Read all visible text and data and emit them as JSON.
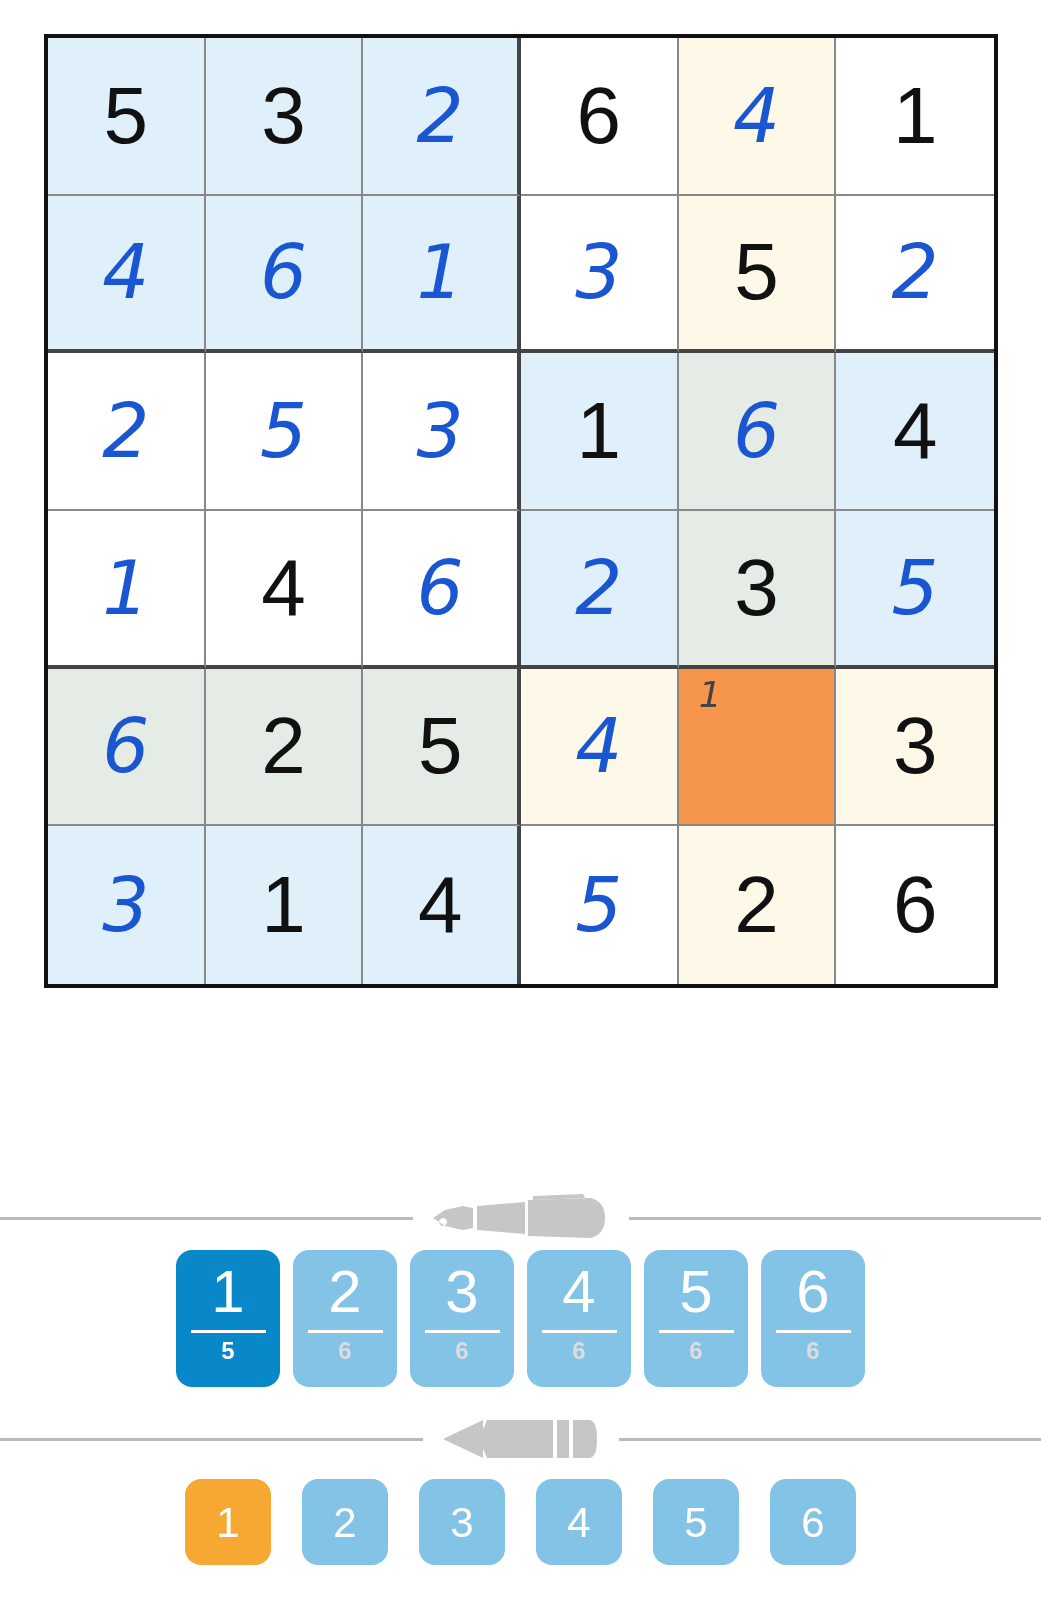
{
  "grid": {
    "rows": [
      [
        {
          "value": "5",
          "kind": "given",
          "in_box": true,
          "in_line": false,
          "selected": false
        },
        {
          "value": "3",
          "kind": "given",
          "in_box": true,
          "in_line": false,
          "selected": false
        },
        {
          "value": "2",
          "kind": "entered",
          "in_box": true,
          "in_line": false,
          "selected": false
        },
        {
          "value": "6",
          "kind": "given",
          "in_box": false,
          "in_line": false,
          "selected": false
        },
        {
          "value": "4",
          "kind": "entered",
          "in_box": false,
          "in_line": true,
          "selected": false
        },
        {
          "value": "1",
          "kind": "given",
          "in_box": false,
          "in_line": false,
          "selected": false
        }
      ],
      [
        {
          "value": "4",
          "kind": "entered",
          "in_box": true,
          "in_line": false,
          "selected": false
        },
        {
          "value": "6",
          "kind": "entered",
          "in_box": true,
          "in_line": false,
          "selected": false
        },
        {
          "value": "1",
          "kind": "entered",
          "in_box": true,
          "in_line": false,
          "selected": false
        },
        {
          "value": "3",
          "kind": "entered",
          "in_box": false,
          "in_line": false,
          "selected": false
        },
        {
          "value": "5",
          "kind": "given",
          "in_box": false,
          "in_line": true,
          "selected": false
        },
        {
          "value": "2",
          "kind": "entered",
          "in_box": false,
          "in_line": false,
          "selected": false
        }
      ],
      [
        {
          "value": "2",
          "kind": "entered",
          "in_box": false,
          "in_line": false,
          "selected": false
        },
        {
          "value": "5",
          "kind": "entered",
          "in_box": false,
          "in_line": false,
          "selected": false
        },
        {
          "value": "3",
          "kind": "entered",
          "in_box": false,
          "in_line": false,
          "selected": false
        },
        {
          "value": "1",
          "kind": "given",
          "in_box": true,
          "in_line": false,
          "selected": false
        },
        {
          "value": "6",
          "kind": "entered",
          "in_box": true,
          "in_line": true,
          "selected": false
        },
        {
          "value": "4",
          "kind": "given",
          "in_box": true,
          "in_line": false,
          "selected": false
        }
      ],
      [
        {
          "value": "1",
          "kind": "entered",
          "in_box": false,
          "in_line": false,
          "selected": false
        },
        {
          "value": "4",
          "kind": "given",
          "in_box": false,
          "in_line": false,
          "selected": false
        },
        {
          "value": "6",
          "kind": "entered",
          "in_box": false,
          "in_line": false,
          "selected": false
        },
        {
          "value": "2",
          "kind": "entered",
          "in_box": true,
          "in_line": false,
          "selected": false
        },
        {
          "value": "3",
          "kind": "given",
          "in_box": true,
          "in_line": true,
          "selected": false
        },
        {
          "value": "5",
          "kind": "entered",
          "in_box": true,
          "in_line": false,
          "selected": false
        }
      ],
      [
        {
          "value": "6",
          "kind": "entered",
          "in_box": true,
          "in_line": true,
          "selected": false
        },
        {
          "value": "2",
          "kind": "given",
          "in_box": true,
          "in_line": true,
          "selected": false
        },
        {
          "value": "5",
          "kind": "given",
          "in_box": true,
          "in_line": true,
          "selected": false
        },
        {
          "value": "4",
          "kind": "entered",
          "in_box": false,
          "in_line": true,
          "selected": false
        },
        {
          "kind": "empty",
          "notes": [
            "1"
          ],
          "selected": true
        },
        {
          "value": "3",
          "kind": "given",
          "in_box": false,
          "in_line": true,
          "selected": false
        }
      ],
      [
        {
          "value": "3",
          "kind": "entered",
          "in_box": true,
          "in_line": false,
          "selected": false
        },
        {
          "value": "1",
          "kind": "given",
          "in_box": true,
          "in_line": false,
          "selected": false
        },
        {
          "value": "4",
          "kind": "given",
          "in_box": true,
          "in_line": false,
          "selected": false
        },
        {
          "value": "5",
          "kind": "entered",
          "in_box": false,
          "in_line": false,
          "selected": false
        },
        {
          "value": "2",
          "kind": "given",
          "in_box": false,
          "in_line": true,
          "selected": false
        },
        {
          "value": "6",
          "kind": "given",
          "in_box": false,
          "in_line": false,
          "selected": false
        }
      ]
    ]
  },
  "pen_pad": [
    {
      "digit": "1",
      "count": "5",
      "selected": true
    },
    {
      "digit": "2",
      "count": "6",
      "selected": false
    },
    {
      "digit": "3",
      "count": "6",
      "selected": false
    },
    {
      "digit": "4",
      "count": "6",
      "selected": false
    },
    {
      "digit": "5",
      "count": "6",
      "selected": false
    },
    {
      "digit": "6",
      "count": "6",
      "selected": false
    }
  ],
  "pencil_pad": [
    {
      "digit": "1",
      "selected": true
    },
    {
      "digit": "2",
      "selected": false
    },
    {
      "digit": "3",
      "selected": false
    },
    {
      "digit": "4",
      "selected": false
    },
    {
      "digit": "5",
      "selected": false
    },
    {
      "digit": "6",
      "selected": false
    }
  ]
}
